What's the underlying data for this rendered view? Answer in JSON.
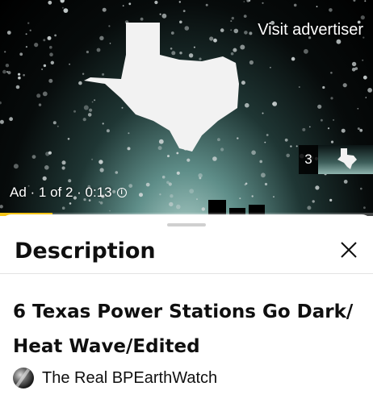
{
  "ad": {
    "visit_label": "Visit advertiser",
    "status_text": "Ad · 1 of 2 · 0:13",
    "info_icon": "info-icon",
    "thumbnail_count": "3",
    "progress": 0.14,
    "colors": {
      "progress": "#f5c518"
    }
  },
  "sheet": {
    "title": "Description",
    "close_icon": "close-icon"
  },
  "video": {
    "title_line1": "6 Texas Power Stations Go Dark/",
    "title_line2": "Heat Wave/Edited",
    "channel_name": "The Real BPEarthWatch"
  }
}
